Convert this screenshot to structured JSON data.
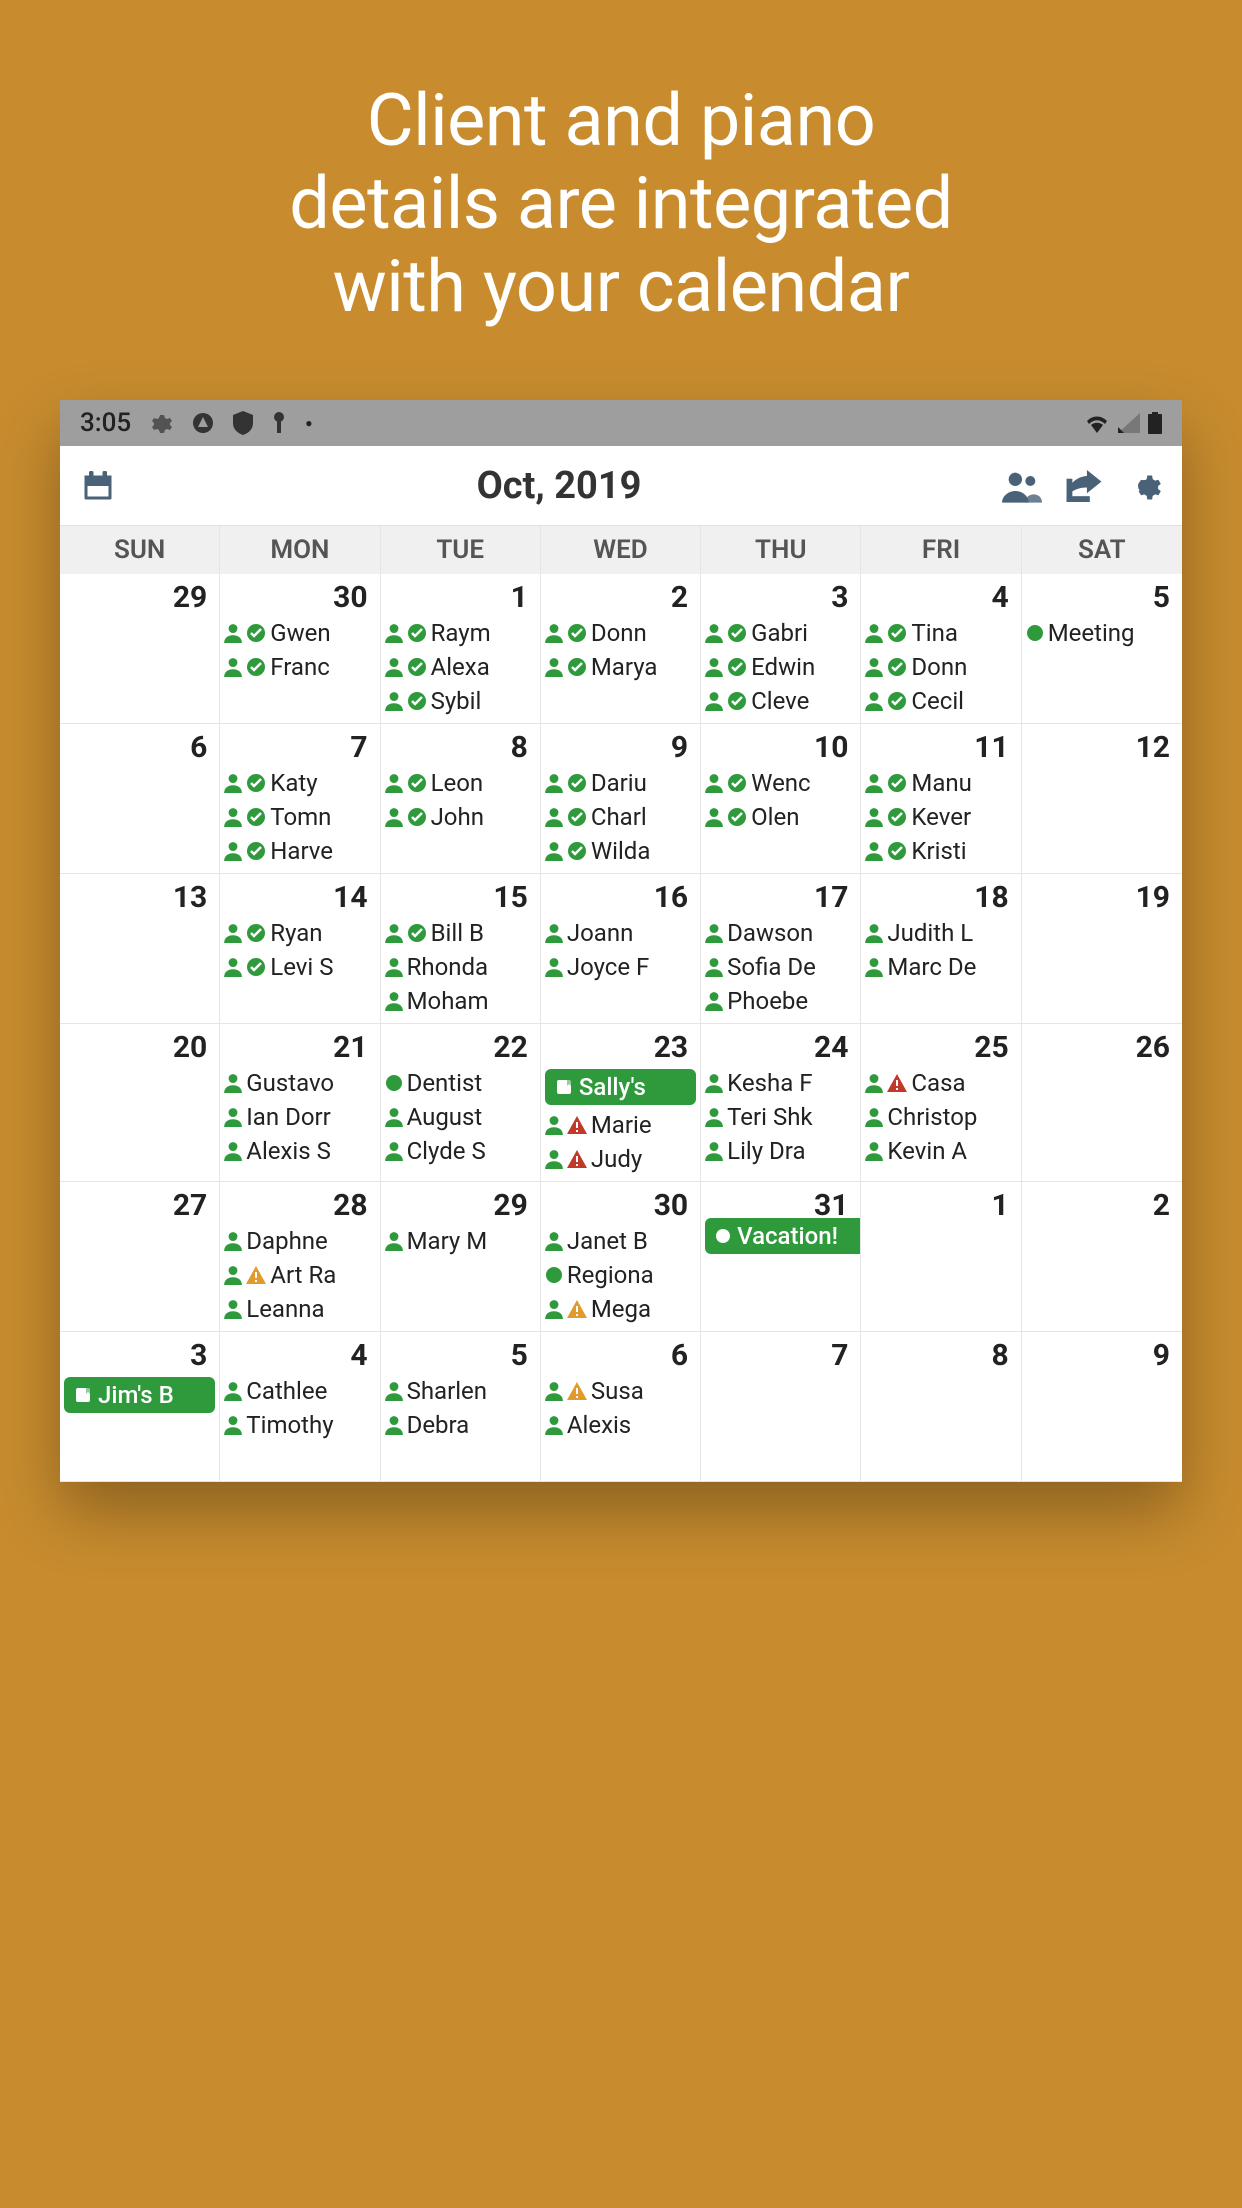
{
  "hero": {
    "line1": "Client and piano",
    "line2": "details are integrated",
    "line3": "with your calendar"
  },
  "status": {
    "time": "3:05"
  },
  "header": {
    "title": "Oct, 2019"
  },
  "weekDays": [
    "SUN",
    "MON",
    "TUE",
    "WED",
    "THU",
    "FRI",
    "SAT"
  ],
  "days": [
    {
      "num": "29",
      "events": []
    },
    {
      "num": "30",
      "events": [
        {
          "t": "pc",
          "label": "Gwen"
        },
        {
          "t": "pc",
          "label": "Franc"
        }
      ]
    },
    {
      "num": "1",
      "events": [
        {
          "t": "pc",
          "label": "Raym"
        },
        {
          "t": "pc",
          "label": "Alexa"
        },
        {
          "t": "pc",
          "label": "Sybil"
        }
      ]
    },
    {
      "num": "2",
      "events": [
        {
          "t": "pc",
          "label": "Donn"
        },
        {
          "t": "pc",
          "label": "Marya"
        }
      ]
    },
    {
      "num": "3",
      "events": [
        {
          "t": "pc",
          "label": "Gabri"
        },
        {
          "t": "pc",
          "label": "Edwin"
        },
        {
          "t": "pc",
          "label": "Cleve"
        }
      ]
    },
    {
      "num": "4",
      "events": [
        {
          "t": "pc",
          "label": "Tina"
        },
        {
          "t": "pc",
          "label": "Donn"
        },
        {
          "t": "pc",
          "label": "Cecil"
        }
      ]
    },
    {
      "num": "5",
      "events": [
        {
          "t": "dot",
          "label": "Meeting"
        }
      ]
    },
    {
      "num": "6",
      "events": []
    },
    {
      "num": "7",
      "events": [
        {
          "t": "pc",
          "label": "Katy"
        },
        {
          "t": "pc",
          "label": "Tomn"
        },
        {
          "t": "pc",
          "label": "Harve"
        }
      ]
    },
    {
      "num": "8",
      "events": [
        {
          "t": "pc",
          "label": "Leon"
        },
        {
          "t": "pc",
          "label": "John"
        }
      ]
    },
    {
      "num": "9",
      "events": [
        {
          "t": "pc",
          "label": "Dariu"
        },
        {
          "t": "pc",
          "label": "Charl"
        },
        {
          "t": "pc",
          "label": "Wilda"
        }
      ]
    },
    {
      "num": "10",
      "events": [
        {
          "t": "pc",
          "label": "Wenc"
        },
        {
          "t": "pc",
          "label": "Olen"
        }
      ]
    },
    {
      "num": "11",
      "events": [
        {
          "t": "pc",
          "label": "Manu"
        },
        {
          "t": "pc",
          "label": "Kever"
        },
        {
          "t": "pc",
          "label": "Kristi"
        }
      ]
    },
    {
      "num": "12",
      "events": []
    },
    {
      "num": "13",
      "events": []
    },
    {
      "num": "14",
      "events": [
        {
          "t": "pc",
          "label": "Ryan"
        },
        {
          "t": "pc",
          "label": "Levi S"
        }
      ]
    },
    {
      "num": "15",
      "events": [
        {
          "t": "pc",
          "label": "Bill B"
        },
        {
          "t": "p",
          "label": "Rhonda"
        },
        {
          "t": "p",
          "label": "Moham"
        }
      ]
    },
    {
      "num": "16",
      "events": [
        {
          "t": "p",
          "label": "Joann"
        },
        {
          "t": "p",
          "label": "Joyce F"
        }
      ]
    },
    {
      "num": "17",
      "events": [
        {
          "t": "p",
          "label": "Dawson"
        },
        {
          "t": "p",
          "label": "Sofia De"
        },
        {
          "t": "p",
          "label": "Phoebe"
        }
      ]
    },
    {
      "num": "18",
      "events": [
        {
          "t": "p",
          "label": "Judith L"
        },
        {
          "t": "p",
          "label": "Marc De"
        }
      ]
    },
    {
      "num": "19",
      "events": []
    },
    {
      "num": "20",
      "events": []
    },
    {
      "num": "21",
      "events": [
        {
          "t": "p",
          "label": "Gustavo"
        },
        {
          "t": "p",
          "label": "Ian Dorr"
        },
        {
          "t": "p",
          "label": "Alexis S"
        }
      ]
    },
    {
      "num": "22",
      "events": [
        {
          "t": "dot",
          "label": "Dentist"
        },
        {
          "t": "p",
          "label": "August"
        },
        {
          "t": "p",
          "label": "Clyde S"
        }
      ]
    },
    {
      "num": "23",
      "events": [
        {
          "t": "banner",
          "label": "Sally's"
        },
        {
          "t": "pa",
          "label": "Marie"
        },
        {
          "t": "pa",
          "label": "Judy"
        }
      ]
    },
    {
      "num": "24",
      "events": [
        {
          "t": "p",
          "label": "Kesha F"
        },
        {
          "t": "p",
          "label": "Teri Shk"
        },
        {
          "t": "p",
          "label": "Lily Dra"
        }
      ]
    },
    {
      "num": "25",
      "events": [
        {
          "t": "pa",
          "label": "Casa"
        },
        {
          "t": "p",
          "label": "Christop"
        },
        {
          "t": "p",
          "label": "Kevin A"
        }
      ]
    },
    {
      "num": "26",
      "events": []
    },
    {
      "num": "27",
      "events": []
    },
    {
      "num": "28",
      "events": [
        {
          "t": "p",
          "label": "Daphne"
        },
        {
          "t": "pw",
          "label": "Art Ra"
        },
        {
          "t": "p",
          "label": "Leanna"
        }
      ]
    },
    {
      "num": "29",
      "events": [
        {
          "t": "p",
          "label": "Mary M"
        }
      ]
    },
    {
      "num": "30",
      "events": [
        {
          "t": "p",
          "label": "Janet B"
        },
        {
          "t": "dot",
          "label": "Regiona"
        },
        {
          "t": "pw",
          "label": "Mega"
        }
      ]
    },
    {
      "num": "31",
      "events": [
        {
          "t": "wbanner",
          "label": "Vacation!",
          "span": 2
        }
      ]
    },
    {
      "num": "1",
      "events": []
    },
    {
      "num": "2",
      "events": []
    },
    {
      "num": "3",
      "events": [
        {
          "t": "banner",
          "label": "Jim's B"
        }
      ]
    },
    {
      "num": "4",
      "events": [
        {
          "t": "p",
          "label": "Cathlee"
        },
        {
          "t": "p",
          "label": "Timothy"
        }
      ]
    },
    {
      "num": "5",
      "events": [
        {
          "t": "p",
          "label": "Sharlen"
        },
        {
          "t": "p",
          "label": "Debra"
        }
      ]
    },
    {
      "num": "6",
      "events": [
        {
          "t": "pw",
          "label": "Susa"
        },
        {
          "t": "p",
          "label": "Alexis"
        }
      ]
    },
    {
      "num": "7",
      "events": []
    },
    {
      "num": "8",
      "events": []
    },
    {
      "num": "9",
      "events": []
    }
  ]
}
